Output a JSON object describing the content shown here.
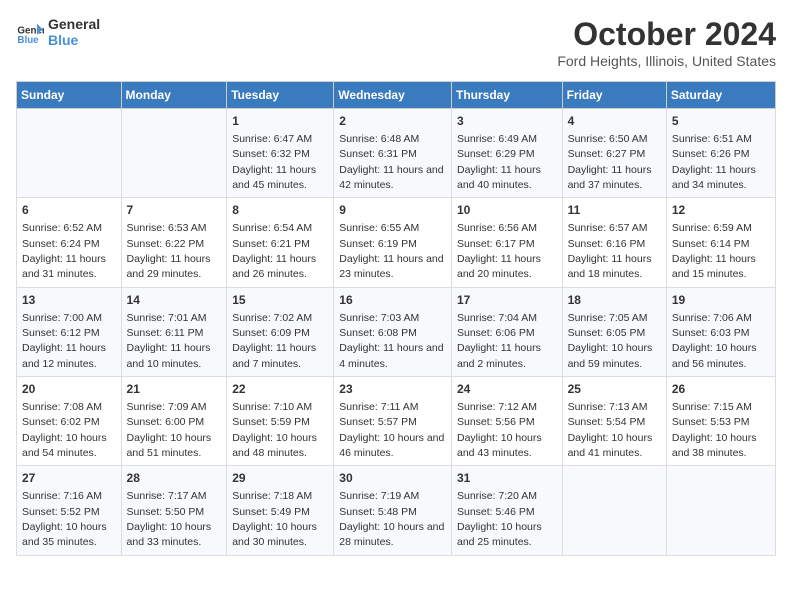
{
  "header": {
    "logo_line1": "General",
    "logo_line2": "Blue",
    "title": "October 2024",
    "subtitle": "Ford Heights, Illinois, United States"
  },
  "days_of_week": [
    "Sunday",
    "Monday",
    "Tuesday",
    "Wednesday",
    "Thursday",
    "Friday",
    "Saturday"
  ],
  "weeks": [
    [
      {
        "day": "",
        "empty": true
      },
      {
        "day": "",
        "empty": true
      },
      {
        "day": "1",
        "sunrise": "6:47 AM",
        "sunset": "6:32 PM",
        "daylight": "11 hours and 45 minutes."
      },
      {
        "day": "2",
        "sunrise": "6:48 AM",
        "sunset": "6:31 PM",
        "daylight": "11 hours and 42 minutes."
      },
      {
        "day": "3",
        "sunrise": "6:49 AM",
        "sunset": "6:29 PM",
        "daylight": "11 hours and 40 minutes."
      },
      {
        "day": "4",
        "sunrise": "6:50 AM",
        "sunset": "6:27 PM",
        "daylight": "11 hours and 37 minutes."
      },
      {
        "day": "5",
        "sunrise": "6:51 AM",
        "sunset": "6:26 PM",
        "daylight": "11 hours and 34 minutes."
      }
    ],
    [
      {
        "day": "6",
        "sunrise": "6:52 AM",
        "sunset": "6:24 PM",
        "daylight": "11 hours and 31 minutes."
      },
      {
        "day": "7",
        "sunrise": "6:53 AM",
        "sunset": "6:22 PM",
        "daylight": "11 hours and 29 minutes."
      },
      {
        "day": "8",
        "sunrise": "6:54 AM",
        "sunset": "6:21 PM",
        "daylight": "11 hours and 26 minutes."
      },
      {
        "day": "9",
        "sunrise": "6:55 AM",
        "sunset": "6:19 PM",
        "daylight": "11 hours and 23 minutes."
      },
      {
        "day": "10",
        "sunrise": "6:56 AM",
        "sunset": "6:17 PM",
        "daylight": "11 hours and 20 minutes."
      },
      {
        "day": "11",
        "sunrise": "6:57 AM",
        "sunset": "6:16 PM",
        "daylight": "11 hours and 18 minutes."
      },
      {
        "day": "12",
        "sunrise": "6:59 AM",
        "sunset": "6:14 PM",
        "daylight": "11 hours and 15 minutes."
      }
    ],
    [
      {
        "day": "13",
        "sunrise": "7:00 AM",
        "sunset": "6:12 PM",
        "daylight": "11 hours and 12 minutes."
      },
      {
        "day": "14",
        "sunrise": "7:01 AM",
        "sunset": "6:11 PM",
        "daylight": "11 hours and 10 minutes."
      },
      {
        "day": "15",
        "sunrise": "7:02 AM",
        "sunset": "6:09 PM",
        "daylight": "11 hours and 7 minutes."
      },
      {
        "day": "16",
        "sunrise": "7:03 AM",
        "sunset": "6:08 PM",
        "daylight": "11 hours and 4 minutes."
      },
      {
        "day": "17",
        "sunrise": "7:04 AM",
        "sunset": "6:06 PM",
        "daylight": "11 hours and 2 minutes."
      },
      {
        "day": "18",
        "sunrise": "7:05 AM",
        "sunset": "6:05 PM",
        "daylight": "10 hours and 59 minutes."
      },
      {
        "day": "19",
        "sunrise": "7:06 AM",
        "sunset": "6:03 PM",
        "daylight": "10 hours and 56 minutes."
      }
    ],
    [
      {
        "day": "20",
        "sunrise": "7:08 AM",
        "sunset": "6:02 PM",
        "daylight": "10 hours and 54 minutes."
      },
      {
        "day": "21",
        "sunrise": "7:09 AM",
        "sunset": "6:00 PM",
        "daylight": "10 hours and 51 minutes."
      },
      {
        "day": "22",
        "sunrise": "7:10 AM",
        "sunset": "5:59 PM",
        "daylight": "10 hours and 48 minutes."
      },
      {
        "day": "23",
        "sunrise": "7:11 AM",
        "sunset": "5:57 PM",
        "daylight": "10 hours and 46 minutes."
      },
      {
        "day": "24",
        "sunrise": "7:12 AM",
        "sunset": "5:56 PM",
        "daylight": "10 hours and 43 minutes."
      },
      {
        "day": "25",
        "sunrise": "7:13 AM",
        "sunset": "5:54 PM",
        "daylight": "10 hours and 41 minutes."
      },
      {
        "day": "26",
        "sunrise": "7:15 AM",
        "sunset": "5:53 PM",
        "daylight": "10 hours and 38 minutes."
      }
    ],
    [
      {
        "day": "27",
        "sunrise": "7:16 AM",
        "sunset": "5:52 PM",
        "daylight": "10 hours and 35 minutes."
      },
      {
        "day": "28",
        "sunrise": "7:17 AM",
        "sunset": "5:50 PM",
        "daylight": "10 hours and 33 minutes."
      },
      {
        "day": "29",
        "sunrise": "7:18 AM",
        "sunset": "5:49 PM",
        "daylight": "10 hours and 30 minutes."
      },
      {
        "day": "30",
        "sunrise": "7:19 AM",
        "sunset": "5:48 PM",
        "daylight": "10 hours and 28 minutes."
      },
      {
        "day": "31",
        "sunrise": "7:20 AM",
        "sunset": "5:46 PM",
        "daylight": "10 hours and 25 minutes."
      },
      {
        "day": "",
        "empty": true
      },
      {
        "day": "",
        "empty": true
      }
    ]
  ]
}
